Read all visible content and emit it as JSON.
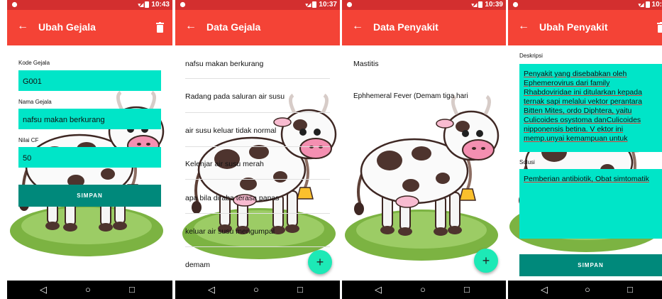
{
  "screens": [
    {
      "status_time": "10:43",
      "title": "Ubah Gejala",
      "fields": [
        {
          "label": "Kode Gejala",
          "value": "G001"
        },
        {
          "label": "Nama Gejala",
          "value": "nafsu makan berkurang"
        },
        {
          "label": "Nilai CF",
          "value": "50"
        }
      ],
      "button": "SIMPAN"
    },
    {
      "status_time": "10:37",
      "title": "Data Gejala",
      "items": [
        "nafsu makan berkurang",
        "Radang pada saluran air susu",
        "air susu keluar tidak normal",
        "Kelenjar air susu merah",
        "apa bila diraba terasa panas",
        "keluar air susu mengumpal",
        "demam"
      ],
      "fab": "+"
    },
    {
      "status_time": "10:39",
      "title": "Data Penyakit",
      "items": [
        "Mastitis",
        "Ephhemeral Fever (Demam tiga hari"
      ],
      "fab": "+"
    },
    {
      "status_time": "10:",
      "title": "Ubah Penyakit",
      "desc_label": "Deskripsi",
      "desc_value": "Penyakit yang disebabkan oleh Ephemerovirus dari family Rhabdoviridae ini ditularkan kepada ternak sapi melalui vektor perantara Bitten Mites, ordo Diphtera, yaitu Culicoides osystoma danCulicoides nipponensis betina. V ektor ini memp.unyai kemampuan untuk",
      "solusi_label": "Solusi",
      "solusi_value": "Pemberian antibiotik, Obat simtomatik",
      "button": "SIMPAN"
    }
  ],
  "nav_icons": [
    "back-triangle",
    "home-circle",
    "recents-square"
  ],
  "colors": {
    "status": "#d32f2f",
    "appbar": "#f44336",
    "field": "#00e5c8",
    "button": "#00897b",
    "fab": "#1de9b6",
    "navbar": "#000000"
  }
}
